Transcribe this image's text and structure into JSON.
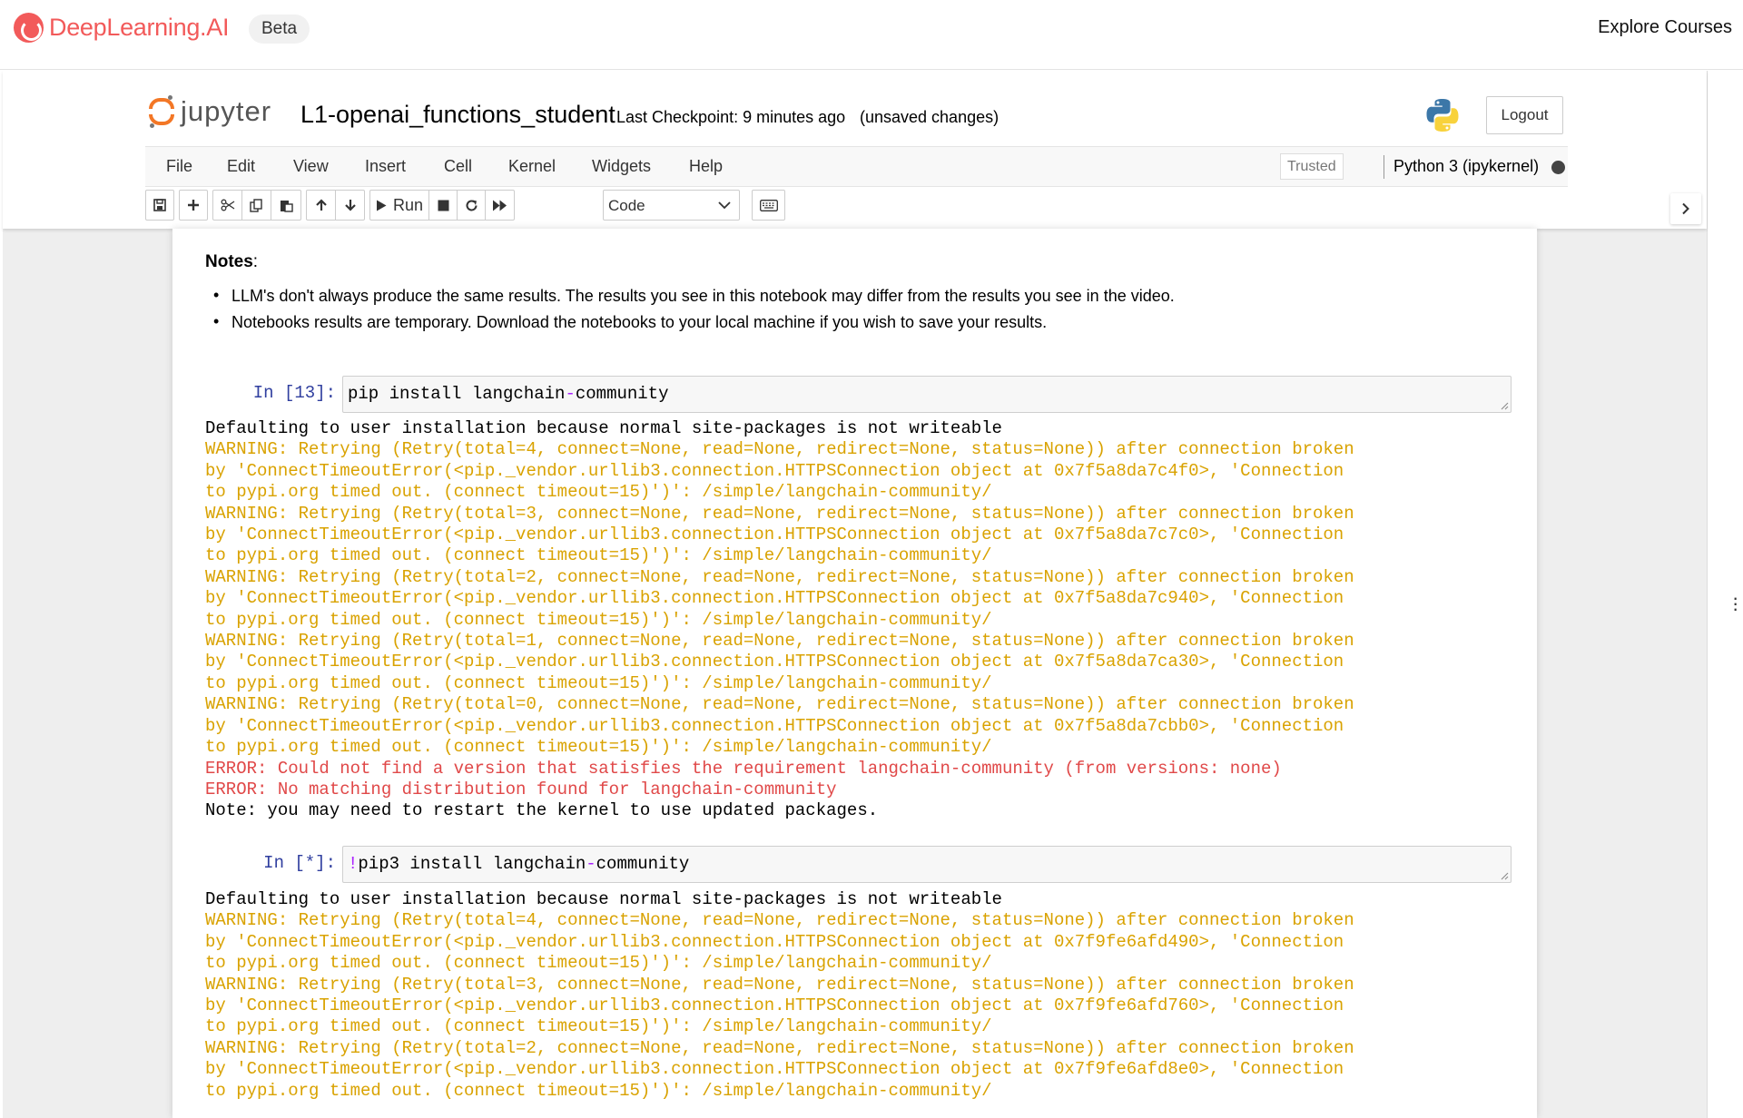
{
  "site": {
    "brand": "DeepLearning.AI",
    "badge": "Beta",
    "explore": "Explore Courses"
  },
  "notebook": {
    "app_name": "jupyter",
    "title": "L1-openai_functions_student",
    "checkpoint": "Last Checkpoint: 9 minutes ago",
    "unsaved": "(unsaved changes)",
    "logout": "Logout"
  },
  "menu": {
    "items": [
      "File",
      "Edit",
      "View",
      "Insert",
      "Cell",
      "Kernel",
      "Widgets",
      "Help"
    ],
    "trusted": "Trusted",
    "kernel": "Python 3 (ipykernel)"
  },
  "toolbar": {
    "run_label": "Run",
    "cell_type": "Code",
    "icons": [
      "save-icon",
      "plus-icon",
      "cut-icon",
      "copy-icon",
      "paste-icon",
      "arrow-up-icon",
      "arrow-down-icon",
      "play-icon",
      "stop-icon",
      "restart-icon",
      "fast-forward-icon",
      "keyboard-icon"
    ]
  },
  "notes": {
    "title": "Notes",
    "colon": ":",
    "items": [
      "LLM's don't always produce the same results. The results you see in this notebook may differ from the results you see in the video.",
      "Notebooks results are temporary. Download the notebooks to your local machine if you wish to save your results."
    ]
  },
  "cells": [
    {
      "prompt": "In [13]:",
      "code_pre": "pip install langchain",
      "code_op": "-",
      "code_post": "community",
      "output": [
        {
          "type": "plain",
          "text": "Defaulting to user installation because normal site-packages is not writeable"
        },
        {
          "type": "warn",
          "text": "WARNING: Retrying (Retry(total=4, connect=None, read=None, redirect=None, status=None)) after connection broken"
        },
        {
          "type": "warn",
          "text": "by 'ConnectTimeoutError(<pip._vendor.urllib3.connection.HTTPSConnection object at 0x7f5a8da7c4f0>, 'Connection"
        },
        {
          "type": "warn",
          "text": "to pypi.org timed out. (connect timeout=15)')': /simple/langchain-community/"
        },
        {
          "type": "warn",
          "text": "WARNING: Retrying (Retry(total=3, connect=None, read=None, redirect=None, status=None)) after connection broken"
        },
        {
          "type": "warn",
          "text": "by 'ConnectTimeoutError(<pip._vendor.urllib3.connection.HTTPSConnection object at 0x7f5a8da7c7c0>, 'Connection"
        },
        {
          "type": "warn",
          "text": "to pypi.org timed out. (connect timeout=15)')': /simple/langchain-community/"
        },
        {
          "type": "warn",
          "text": "WARNING: Retrying (Retry(total=2, connect=None, read=None, redirect=None, status=None)) after connection broken"
        },
        {
          "type": "warn",
          "text": "by 'ConnectTimeoutError(<pip._vendor.urllib3.connection.HTTPSConnection object at 0x7f5a8da7c940>, 'Connection"
        },
        {
          "type": "warn",
          "text": "to pypi.org timed out. (connect timeout=15)')': /simple/langchain-community/"
        },
        {
          "type": "warn",
          "text": "WARNING: Retrying (Retry(total=1, connect=None, read=None, redirect=None, status=None)) after connection broken"
        },
        {
          "type": "warn",
          "text": "by 'ConnectTimeoutError(<pip._vendor.urllib3.connection.HTTPSConnection object at 0x7f5a8da7ca30>, 'Connection"
        },
        {
          "type": "warn",
          "text": "to pypi.org timed out. (connect timeout=15)')': /simple/langchain-community/"
        },
        {
          "type": "warn",
          "text": "WARNING: Retrying (Retry(total=0, connect=None, read=None, redirect=None, status=None)) after connection broken"
        },
        {
          "type": "warn",
          "text": "by 'ConnectTimeoutError(<pip._vendor.urllib3.connection.HTTPSConnection object at 0x7f5a8da7cbb0>, 'Connection"
        },
        {
          "type": "warn",
          "text": "to pypi.org timed out. (connect timeout=15)')': /simple/langchain-community/"
        },
        {
          "type": "err",
          "text": "ERROR: Could not find a version that satisfies the requirement langchain-community (from versions: none)"
        },
        {
          "type": "err",
          "text": "ERROR: No matching distribution found for langchain-community"
        },
        {
          "type": "plain",
          "text": "Note: you may need to restart the kernel to use updated packages."
        }
      ]
    },
    {
      "prompt": "In [*]:",
      "code_bang": "!",
      "code_pre": "pip3 install langchain",
      "code_op": "-",
      "code_post": "community",
      "output": [
        {
          "type": "plain",
          "text": "Defaulting to user installation because normal site-packages is not writeable"
        },
        {
          "type": "warn",
          "text": "WARNING: Retrying (Retry(total=4, connect=None, read=None, redirect=None, status=None)) after connection broken"
        },
        {
          "type": "warn",
          "text": "by 'ConnectTimeoutError(<pip._vendor.urllib3.connection.HTTPSConnection object at 0x7f9fe6afd490>, 'Connection"
        },
        {
          "type": "warn",
          "text": "to pypi.org timed out. (connect timeout=15)')': /simple/langchain-community/"
        },
        {
          "type": "warn",
          "text": "WARNING: Retrying (Retry(total=3, connect=None, read=None, redirect=None, status=None)) after connection broken"
        },
        {
          "type": "warn",
          "text": "by 'ConnectTimeoutError(<pip._vendor.urllib3.connection.HTTPSConnection object at 0x7f9fe6afd760>, 'Connection"
        },
        {
          "type": "warn",
          "text": "to pypi.org timed out. (connect timeout=15)')': /simple/langchain-community/"
        },
        {
          "type": "warn",
          "text": "WARNING: Retrying (Retry(total=2, connect=None, read=None, redirect=None, status=None)) after connection broken"
        },
        {
          "type": "warn",
          "text": "by 'ConnectTimeoutError(<pip._vendor.urllib3.connection.HTTPSConnection object at 0x7f9fe6afd8e0>, 'Connection"
        },
        {
          "type": "warn",
          "text": "to pypi.org timed out. (connect timeout=15)')': /simple/langchain-community/"
        }
      ]
    }
  ],
  "colors": {
    "brand": "#f25a5a",
    "jupyter_orange": "#f37726",
    "prompt_blue": "#303f9f",
    "warning": "#d9a200",
    "error": "#e04848"
  }
}
